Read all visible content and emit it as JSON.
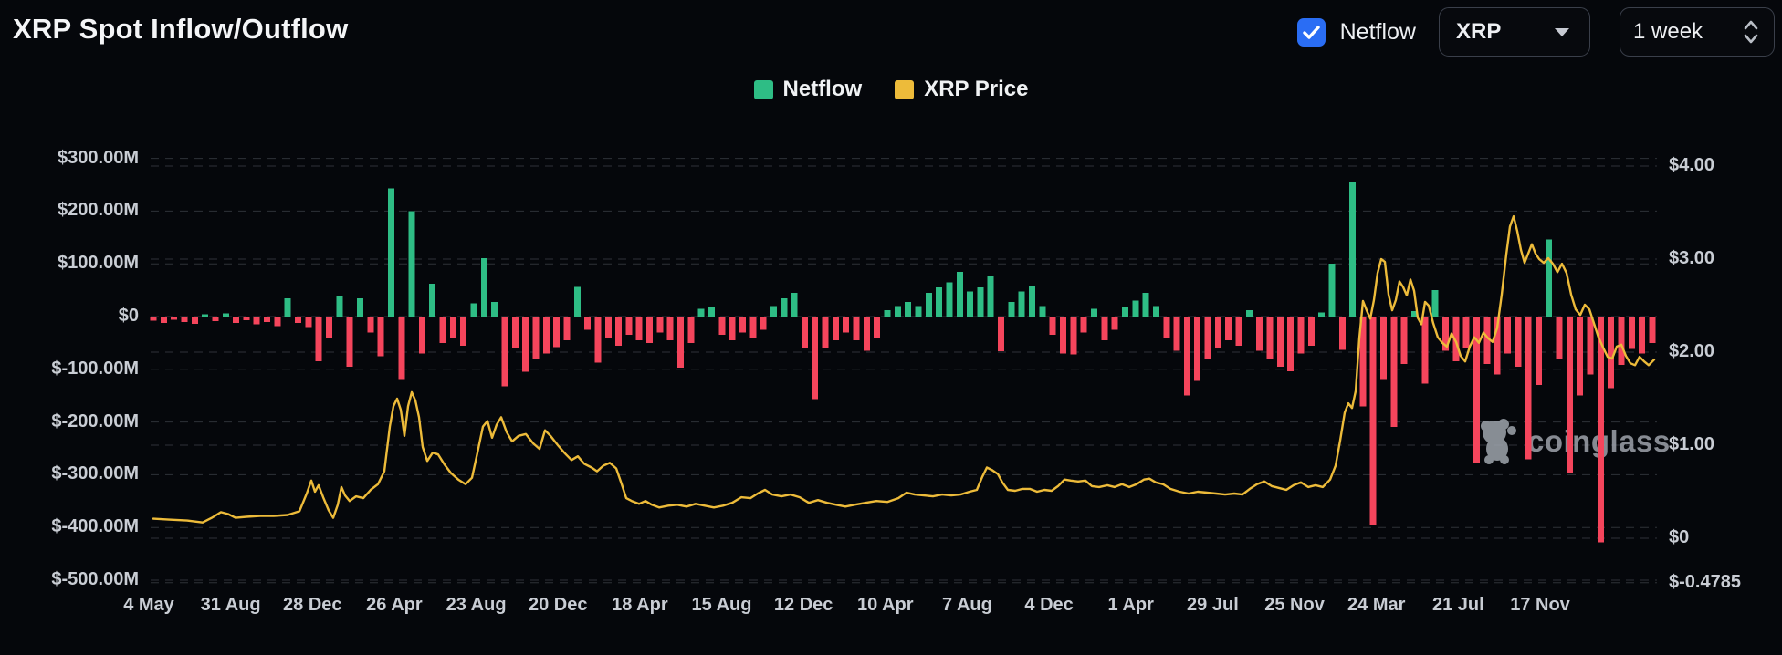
{
  "header": {
    "title": "XRP Spot Inflow/Outflow",
    "netflow_toggle": {
      "label": "Netflow",
      "checked": true
    },
    "symbol_select": {
      "value": "XRP"
    },
    "interval_select": {
      "value": "1 week"
    }
  },
  "legend": {
    "items": [
      {
        "label": "Netflow",
        "color": "#2EBD85"
      },
      {
        "label": "XRP Price",
        "color": "#EDBB3A"
      }
    ]
  },
  "watermark": {
    "label": "coinglass"
  },
  "chart_data": {
    "type": "combo_bar_line",
    "title": "XRP Spot Inflow/Outflow",
    "interval": "1 week",
    "grid": true,
    "left_axis": {
      "unit": "USD millions",
      "range": [
        -500,
        300
      ],
      "ticks": [
        {
          "label": "$300.00M",
          "value": 300
        },
        {
          "label": "$200.00M",
          "value": 200
        },
        {
          "label": "$100.00M",
          "value": 100
        },
        {
          "label": "$0",
          "value": 0
        },
        {
          "label": "$-100.00M",
          "value": -100
        },
        {
          "label": "$-200.00M",
          "value": -200
        },
        {
          "label": "$-300.00M",
          "value": -300
        },
        {
          "label": "$-400.00M",
          "value": -400
        },
        {
          "label": "$-500.00M",
          "value": -500
        }
      ]
    },
    "right_axis": {
      "unit": "USD",
      "range": [
        -0.4785,
        4.2
      ],
      "ticks": [
        {
          "label": "$4.00",
          "value": 4
        },
        {
          "label": "$3.00",
          "value": 3
        },
        {
          "label": "$2.00",
          "value": 2
        },
        {
          "label": "$1.00",
          "value": 1
        },
        {
          "label": "$0",
          "value": 0
        },
        {
          "label": "$-0.4785",
          "value": -0.4785
        }
      ]
    },
    "x_axis": {
      "labels": [
        "4 May",
        "31 Aug",
        "28 Dec",
        "26 Apr",
        "23 Aug",
        "20 Dec",
        "18 Apr",
        "15 Aug",
        "12 Dec",
        "10 Apr",
        "7 Aug",
        "4 Dec",
        "1 Apr",
        "29 Jul",
        "25 Nov",
        "24 Mar",
        "21 Jul",
        "17 Nov"
      ]
    },
    "series": [
      {
        "name": "Netflow",
        "type": "bar",
        "axis": "left",
        "unit": "USD millions",
        "color_positive": "#2EBD85",
        "color_negative": "#F5455C",
        "values": [
          -8,
          -12,
          -6,
          -10,
          -14,
          4,
          -9,
          6,
          -12,
          -7,
          -15,
          -10,
          -18,
          35,
          -12,
          -20,
          -85,
          -40,
          38,
          -95,
          35,
          -30,
          -75,
          243,
          -120,
          200,
          -70,
          62,
          -50,
          -40,
          -55,
          25,
          111,
          28,
          -132,
          -60,
          -105,
          -80,
          -70,
          -58,
          -45,
          56,
          -25,
          -87,
          -40,
          -55,
          -35,
          -45,
          -50,
          -30,
          -45,
          -97,
          -50,
          15,
          18,
          -35,
          -45,
          -30,
          -40,
          -25,
          20,
          35,
          45,
          -60,
          -157,
          -60,
          -45,
          -30,
          -45,
          -65,
          -40,
          12,
          20,
          28,
          20,
          45,
          55,
          65,
          85,
          48,
          55,
          77,
          -66,
          28,
          48,
          58,
          20,
          -35,
          -70,
          -72,
          -30,
          15,
          -45,
          -25,
          18,
          30,
          45,
          20,
          -40,
          -65,
          -150,
          -122,
          -80,
          -60,
          -45,
          -55,
          12,
          -65,
          -80,
          -95,
          -104,
          -70,
          -55,
          8,
          100,
          -63,
          255,
          -170,
          -395,
          -120,
          -209,
          -90,
          10,
          -127,
          50,
          -65,
          -85,
          -60,
          -278,
          -90,
          -110,
          -70,
          -95,
          -271,
          -130,
          146,
          -80,
          -297,
          -150,
          -110,
          -428,
          -136,
          -92,
          -61,
          -70,
          -50
        ]
      },
      {
        "name": "XRP Price",
        "type": "line",
        "axis": "right",
        "unit": "USD",
        "color": "#EDBB3A",
        "points": [
          [
            168,
            0.21
          ],
          [
            185,
            0.2
          ],
          [
            205,
            0.19
          ],
          [
            222,
            0.17
          ],
          [
            232,
            0.22
          ],
          [
            242,
            0.28
          ],
          [
            250,
            0.26
          ],
          [
            258,
            0.22
          ],
          [
            270,
            0.23
          ],
          [
            285,
            0.24
          ],
          [
            300,
            0.24
          ],
          [
            315,
            0.25
          ],
          [
            328,
            0.29
          ],
          [
            336,
            0.48
          ],
          [
            341,
            0.62
          ],
          [
            345,
            0.5
          ],
          [
            349,
            0.57
          ],
          [
            354,
            0.44
          ],
          [
            360,
            0.3
          ],
          [
            365,
            0.22
          ],
          [
            370,
            0.36
          ],
          [
            374,
            0.55
          ],
          [
            378,
            0.46
          ],
          [
            383,
            0.4
          ],
          [
            390,
            0.45
          ],
          [
            398,
            0.43
          ],
          [
            406,
            0.52
          ],
          [
            414,
            0.58
          ],
          [
            421,
            0.72
          ],
          [
            427,
            1.2
          ],
          [
            431,
            1.42
          ],
          [
            435,
            1.5
          ],
          [
            439,
            1.38
          ],
          [
            443,
            1.1
          ],
          [
            447,
            1.42
          ],
          [
            451,
            1.57
          ],
          [
            455,
            1.48
          ],
          [
            459,
            1.3
          ],
          [
            463,
            0.98
          ],
          [
            468,
            0.83
          ],
          [
            474,
            0.92
          ],
          [
            480,
            0.9
          ],
          [
            487,
            0.79
          ],
          [
            494,
            0.7
          ],
          [
            502,
            0.63
          ],
          [
            510,
            0.58
          ],
          [
            517,
            0.65
          ],
          [
            523,
            0.92
          ],
          [
            529,
            1.2
          ],
          [
            534,
            1.26
          ],
          [
            539,
            1.08
          ],
          [
            544,
            1.22
          ],
          [
            549,
            1.3
          ],
          [
            555,
            1.14
          ],
          [
            561,
            1.04
          ],
          [
            568,
            1.1
          ],
          [
            576,
            1.12
          ],
          [
            584,
            1.02
          ],
          [
            591,
            0.96
          ],
          [
            597,
            1.16
          ],
          [
            603,
            1.1
          ],
          [
            611,
            1.0
          ],
          [
            619,
            0.91
          ],
          [
            626,
            0.84
          ],
          [
            633,
            0.88
          ],
          [
            640,
            0.8
          ],
          [
            648,
            0.76
          ],
          [
            654,
            0.72
          ],
          [
            661,
            0.78
          ],
          [
            668,
            0.81
          ],
          [
            675,
            0.75
          ],
          [
            681,
            0.58
          ],
          [
            686,
            0.43
          ],
          [
            692,
            0.4
          ],
          [
            700,
            0.37
          ],
          [
            707,
            0.4
          ],
          [
            714,
            0.36
          ],
          [
            722,
            0.33
          ],
          [
            732,
            0.35
          ],
          [
            742,
            0.36
          ],
          [
            752,
            0.34
          ],
          [
            762,
            0.37
          ],
          [
            772,
            0.35
          ],
          [
            782,
            0.33
          ],
          [
            792,
            0.35
          ],
          [
            802,
            0.38
          ],
          [
            812,
            0.44
          ],
          [
            822,
            0.43
          ],
          [
            830,
            0.48
          ],
          [
            838,
            0.52
          ],
          [
            846,
            0.47
          ],
          [
            856,
            0.45
          ],
          [
            866,
            0.47
          ],
          [
            876,
            0.44
          ],
          [
            886,
            0.38
          ],
          [
            896,
            0.41
          ],
          [
            906,
            0.38
          ],
          [
            916,
            0.36
          ],
          [
            926,
            0.34
          ],
          [
            936,
            0.36
          ],
          [
            948,
            0.38
          ],
          [
            960,
            0.4
          ],
          [
            972,
            0.39
          ],
          [
            984,
            0.43
          ],
          [
            993,
            0.49
          ],
          [
            1002,
            0.47
          ],
          [
            1012,
            0.46
          ],
          [
            1022,
            0.45
          ],
          [
            1032,
            0.47
          ],
          [
            1042,
            0.46
          ],
          [
            1052,
            0.47
          ],
          [
            1062,
            0.5
          ],
          [
            1070,
            0.52
          ],
          [
            1076,
            0.66
          ],
          [
            1081,
            0.76
          ],
          [
            1087,
            0.73
          ],
          [
            1093,
            0.69
          ],
          [
            1098,
            0.6
          ],
          [
            1104,
            0.52
          ],
          [
            1112,
            0.51
          ],
          [
            1120,
            0.53
          ],
          [
            1128,
            0.53
          ],
          [
            1136,
            0.5
          ],
          [
            1144,
            0.52
          ],
          [
            1152,
            0.51
          ],
          [
            1159,
            0.56
          ],
          [
            1166,
            0.63
          ],
          [
            1173,
            0.62
          ],
          [
            1181,
            0.61
          ],
          [
            1189,
            0.62
          ],
          [
            1196,
            0.56
          ],
          [
            1204,
            0.55
          ],
          [
            1213,
            0.57
          ],
          [
            1221,
            0.55
          ],
          [
            1229,
            0.58
          ],
          [
            1237,
            0.55
          ],
          [
            1245,
            0.58
          ],
          [
            1253,
            0.63
          ],
          [
            1259,
            0.64
          ],
          [
            1266,
            0.6
          ],
          [
            1274,
            0.58
          ],
          [
            1282,
            0.53
          ],
          [
            1292,
            0.5
          ],
          [
            1302,
            0.48
          ],
          [
            1312,
            0.5
          ],
          [
            1322,
            0.49
          ],
          [
            1332,
            0.48
          ],
          [
            1342,
            0.47
          ],
          [
            1352,
            0.48
          ],
          [
            1361,
            0.47
          ],
          [
            1369,
            0.53
          ],
          [
            1377,
            0.58
          ],
          [
            1385,
            0.61
          ],
          [
            1393,
            0.56
          ],
          [
            1401,
            0.54
          ],
          [
            1409,
            0.52
          ],
          [
            1417,
            0.57
          ],
          [
            1425,
            0.6
          ],
          [
            1433,
            0.55
          ],
          [
            1441,
            0.57
          ],
          [
            1449,
            0.55
          ],
          [
            1457,
            0.63
          ],
          [
            1463,
            0.78
          ],
          [
            1468,
            1.05
          ],
          [
            1473,
            1.35
          ],
          [
            1477,
            1.45
          ],
          [
            1481,
            1.4
          ],
          [
            1485,
            1.58
          ],
          [
            1489,
            2.15
          ],
          [
            1493,
            2.55
          ],
          [
            1497,
            2.45
          ],
          [
            1501,
            2.36
          ],
          [
            1505,
            2.56
          ],
          [
            1509,
            2.85
          ],
          [
            1513,
            3.0
          ],
          [
            1517,
            2.97
          ],
          [
            1521,
            2.62
          ],
          [
            1525,
            2.45
          ],
          [
            1529,
            2.56
          ],
          [
            1533,
            2.76
          ],
          [
            1537,
            2.7
          ],
          [
            1541,
            2.61
          ],
          [
            1545,
            2.78
          ],
          [
            1549,
            2.66
          ],
          [
            1553,
            2.37
          ],
          [
            1557,
            2.3
          ],
          [
            1561,
            2.54
          ],
          [
            1565,
            2.5
          ],
          [
            1570,
            2.31
          ],
          [
            1575,
            2.16
          ],
          [
            1580,
            2.1
          ],
          [
            1585,
            2.06
          ],
          [
            1590,
            2.2
          ],
          [
            1595,
            2.11
          ],
          [
            1600,
            1.96
          ],
          [
            1605,
            1.9
          ],
          [
            1610,
            2.06
          ],
          [
            1615,
            2.16
          ],
          [
            1620,
            2.1
          ],
          [
            1625,
            2.21
          ],
          [
            1630,
            2.15
          ],
          [
            1635,
            2.11
          ],
          [
            1640,
            2.26
          ],
          [
            1645,
            2.62
          ],
          [
            1650,
            3.05
          ],
          [
            1654,
            3.35
          ],
          [
            1658,
            3.46
          ],
          [
            1662,
            3.3
          ],
          [
            1666,
            3.1
          ],
          [
            1670,
            2.96
          ],
          [
            1674,
            3.06
          ],
          [
            1678,
            3.16
          ],
          [
            1682,
            3.06
          ],
          [
            1686,
            3.0
          ],
          [
            1691,
            2.96
          ],
          [
            1696,
            3.01
          ],
          [
            1701,
            2.95
          ],
          [
            1706,
            2.86
          ],
          [
            1711,
            2.95
          ],
          [
            1716,
            2.85
          ],
          [
            1721,
            2.62
          ],
          [
            1726,
            2.46
          ],
          [
            1731,
            2.4
          ],
          [
            1736,
            2.51
          ],
          [
            1741,
            2.46
          ],
          [
            1746,
            2.31
          ],
          [
            1751,
            2.16
          ],
          [
            1756,
            2.05
          ],
          [
            1761,
            1.95
          ],
          [
            1766,
            1.93
          ],
          [
            1771,
            2.06
          ],
          [
            1776,
            2.08
          ],
          [
            1781,
            1.96
          ],
          [
            1786,
            1.88
          ],
          [
            1791,
            1.86
          ],
          [
            1796,
            1.95
          ],
          [
            1801,
            1.9
          ],
          [
            1806,
            1.86
          ],
          [
            1812,
            1.92
          ]
        ]
      }
    ]
  }
}
